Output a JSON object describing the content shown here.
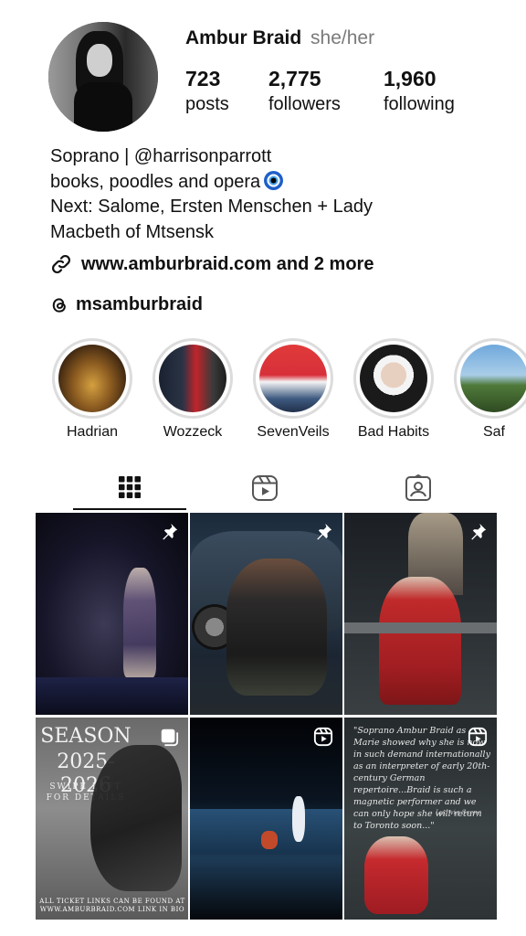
{
  "profile": {
    "name": "Ambur Braid",
    "pronouns": "she/her",
    "stats": {
      "posts": {
        "value": "723",
        "label": "posts"
      },
      "followers": {
        "value": "2,775",
        "label": "followers"
      },
      "following": {
        "value": "1,960",
        "label": "following"
      }
    },
    "bio": {
      "line1": "Soprano | @harrisonparrott",
      "line2": "books, poodles and opera",
      "line3": "Next: Salome, Ersten Menschen + Lady",
      "line4": "Macbeth of Mtsensk"
    },
    "link": "www.amburbraid.com and 2 more",
    "threads": "msamburbraid"
  },
  "highlights": [
    {
      "label": "Hadrian"
    },
    {
      "label": "Wozzeck"
    },
    {
      "label": "SevenVeils"
    },
    {
      "label": "Bad Habits"
    },
    {
      "label": "Saf"
    }
  ],
  "tabs": {
    "grid": "grid-icon",
    "reels": "reels-icon",
    "tagged": "tagged-icon"
  },
  "posts": {
    "p4_title1": "SEASON",
    "p4_title2": "2025-2026",
    "p4_sub": "SWIPE LEFT FOR DETAILS",
    "p4_foot": "ALL TICKET LINKS CAN BE FOUND AT WWW.AMBURBRAID.COM LINK IN BIO",
    "p6_quote": "\"Soprano Ambur Braid as Marie showed why she is now in such demand internationally as an interpreter of early 20th-century German repertoire...Braid is such a magnetic performer and we can only hope she will return to Toronto soon...\"",
    "p6_source": "Ludwig Scena"
  }
}
